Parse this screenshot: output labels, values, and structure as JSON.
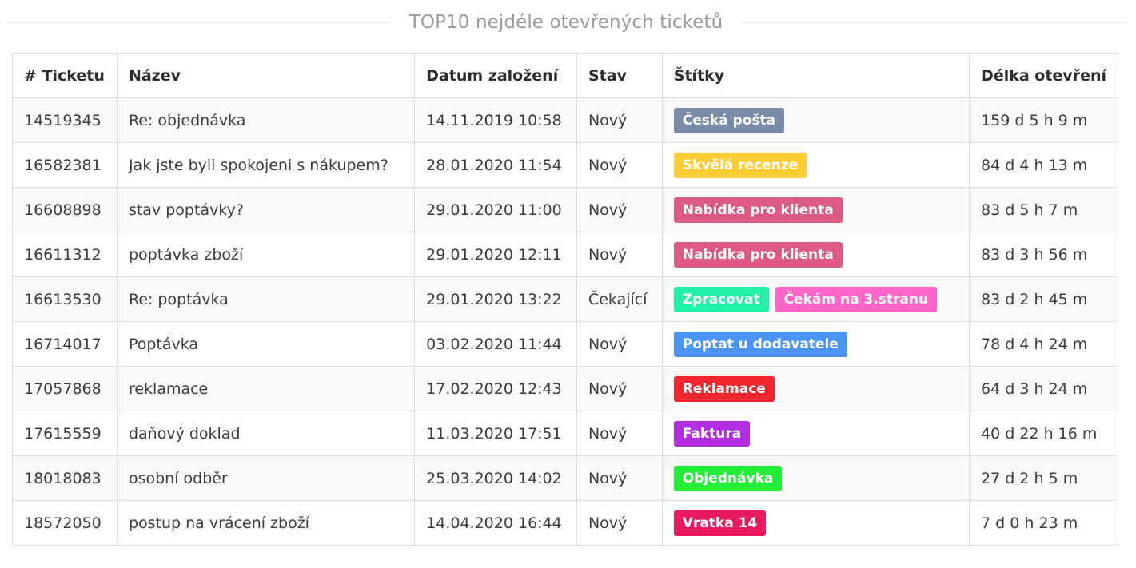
{
  "title": "TOP10 nejdéle otevřených ticketů",
  "columns": [
    "# Ticketu",
    "Název",
    "Datum založení",
    "Stav",
    "Štítky",
    "Délka otevření"
  ],
  "rows": [
    {
      "id": "14519345",
      "name": "Re: objednávka",
      "date": "14.11.2019 10:58",
      "state": "Nový",
      "tags": [
        {
          "label": "Česká pošta",
          "color": "#7a8ba8"
        }
      ],
      "duration": "159 d 5 h 9 m"
    },
    {
      "id": "16582381",
      "name": "Jak jste byli spokojeni s nákupem?",
      "date": "28.01.2020 11:54",
      "state": "Nový",
      "tags": [
        {
          "label": "Skvělá recenze",
          "color": "#ffcc33"
        }
      ],
      "duration": "84 d 4 h 13 m"
    },
    {
      "id": "16608898",
      "name": "stav poptávky?",
      "date": "29.01.2020 11:00",
      "state": "Nový",
      "tags": [
        {
          "label": "Nabídka pro klienta",
          "color": "#dc5a84"
        }
      ],
      "duration": "83 d 5 h 7 m"
    },
    {
      "id": "16611312",
      "name": "poptávka zboží",
      "date": "29.01.2020 12:11",
      "state": "Nový",
      "tags": [
        {
          "label": "Nabídka pro klienta",
          "color": "#dc5a84"
        }
      ],
      "duration": "83 d 3 h 56 m"
    },
    {
      "id": "16613530",
      "name": "Re: poptávka",
      "date": "29.01.2020 13:22",
      "state": "Čekající",
      "tags": [
        {
          "label": "Zpracovat",
          "color": "#21f0a6"
        },
        {
          "label": "Čekám na 3.stranu",
          "color": "#ff66c8"
        }
      ],
      "duration": "83 d 2 h 45 m"
    },
    {
      "id": "16714017",
      "name": "Poptávka",
      "date": "03.02.2020 11:44",
      "state": "Nový",
      "tags": [
        {
          "label": "Poptat u dodavatele",
          "color": "#4a94f7"
        }
      ],
      "duration": "78 d 4 h 24 m"
    },
    {
      "id": "17057868",
      "name": "reklamace",
      "date": "17.02.2020 12:43",
      "state": "Nový",
      "tags": [
        {
          "label": "Reklamace",
          "color": "#f0252e"
        }
      ],
      "duration": "64 d 3 h 24 m"
    },
    {
      "id": "17615559",
      "name": "daňový doklad",
      "date": "11.03.2020 17:51",
      "state": "Nový",
      "tags": [
        {
          "label": "Faktura",
          "color": "#b12ee0"
        }
      ],
      "duration": "40 d 22 h 16 m"
    },
    {
      "id": "18018083",
      "name": "osobní odběr",
      "date": "25.03.2020 14:02",
      "state": "Nový",
      "tags": [
        {
          "label": "Objednávka",
          "color": "#22ee3a"
        }
      ],
      "duration": "27 d 2 h 5 m"
    },
    {
      "id": "18572050",
      "name": "postup na vrácení zboží",
      "date": "14.04.2020 16:44",
      "state": "Nový",
      "tags": [
        {
          "label": "Vratka 14",
          "color": "#e8195e"
        }
      ],
      "duration": "7 d 0 h 23 m"
    }
  ]
}
